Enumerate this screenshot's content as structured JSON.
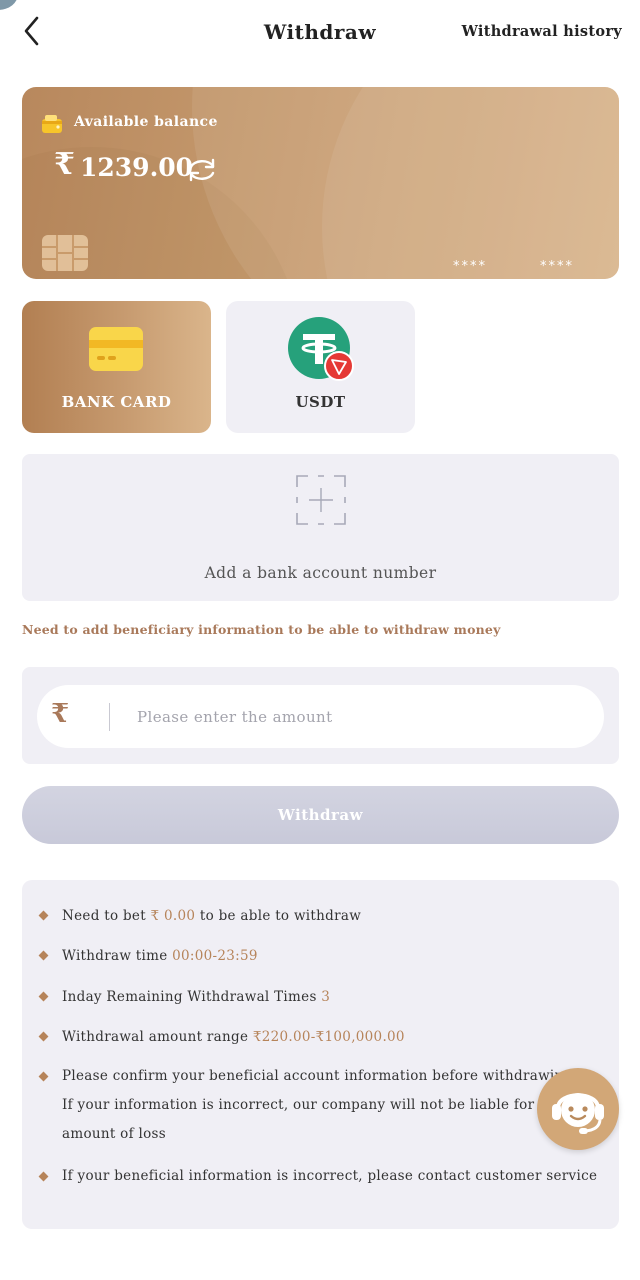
{
  "header": {
    "title": "Withdraw",
    "history_link": "Withdrawal history",
    "back_icon": "chevron-left-icon"
  },
  "balance_card": {
    "label": "Available balance",
    "currency_symbol": "₹",
    "amount": "1239.00",
    "masked_group_1": "****",
    "masked_group_2": "****",
    "icons": [
      "wallet-icon",
      "refresh-icon",
      "card-chip-icon"
    ]
  },
  "methods": [
    {
      "label": "BANK CARD",
      "icon": "bank-card-icon",
      "selected": true
    },
    {
      "label": "USDT",
      "icon": "tether-trc20-icon",
      "selected": false
    }
  ],
  "add_bank": {
    "label": "Add a bank account number",
    "icon": "add-scan-icon"
  },
  "notice": "Need to add beneficiary information to be able to withdraw money",
  "amount_input": {
    "currency_symbol": "₹",
    "placeholder": "Please enter the amount",
    "value": ""
  },
  "withdraw_button": "Withdraw",
  "rules": {
    "bet": {
      "prefix": "Need to bet ",
      "value": "₹ 0.00",
      "suffix": " to be able to withdraw"
    },
    "time": {
      "prefix": "Withdraw time ",
      "value": "00:00-23:59"
    },
    "remaining": {
      "prefix": "Inday Remaining Withdrawal Times ",
      "value": "3"
    },
    "range": {
      "prefix": "Withdrawal amount range ",
      "value": "₹220.00-₹100,000.00"
    },
    "confirm": "Please confirm your beneficial account information before withdrawing. If your information is incorrect, our company will not be liable for the amount of loss",
    "contact": "If your beneficial information is incorrect, please contact customer service"
  },
  "colors": {
    "accent": "#b6845a",
    "card_gradient_start": "#b8885d",
    "card_gradient_end": "#d6af83",
    "panel_bg": "#f0eff5",
    "button_disabled": "#cbccda"
  },
  "customer_service_icon": "customer-service-headset-icon"
}
